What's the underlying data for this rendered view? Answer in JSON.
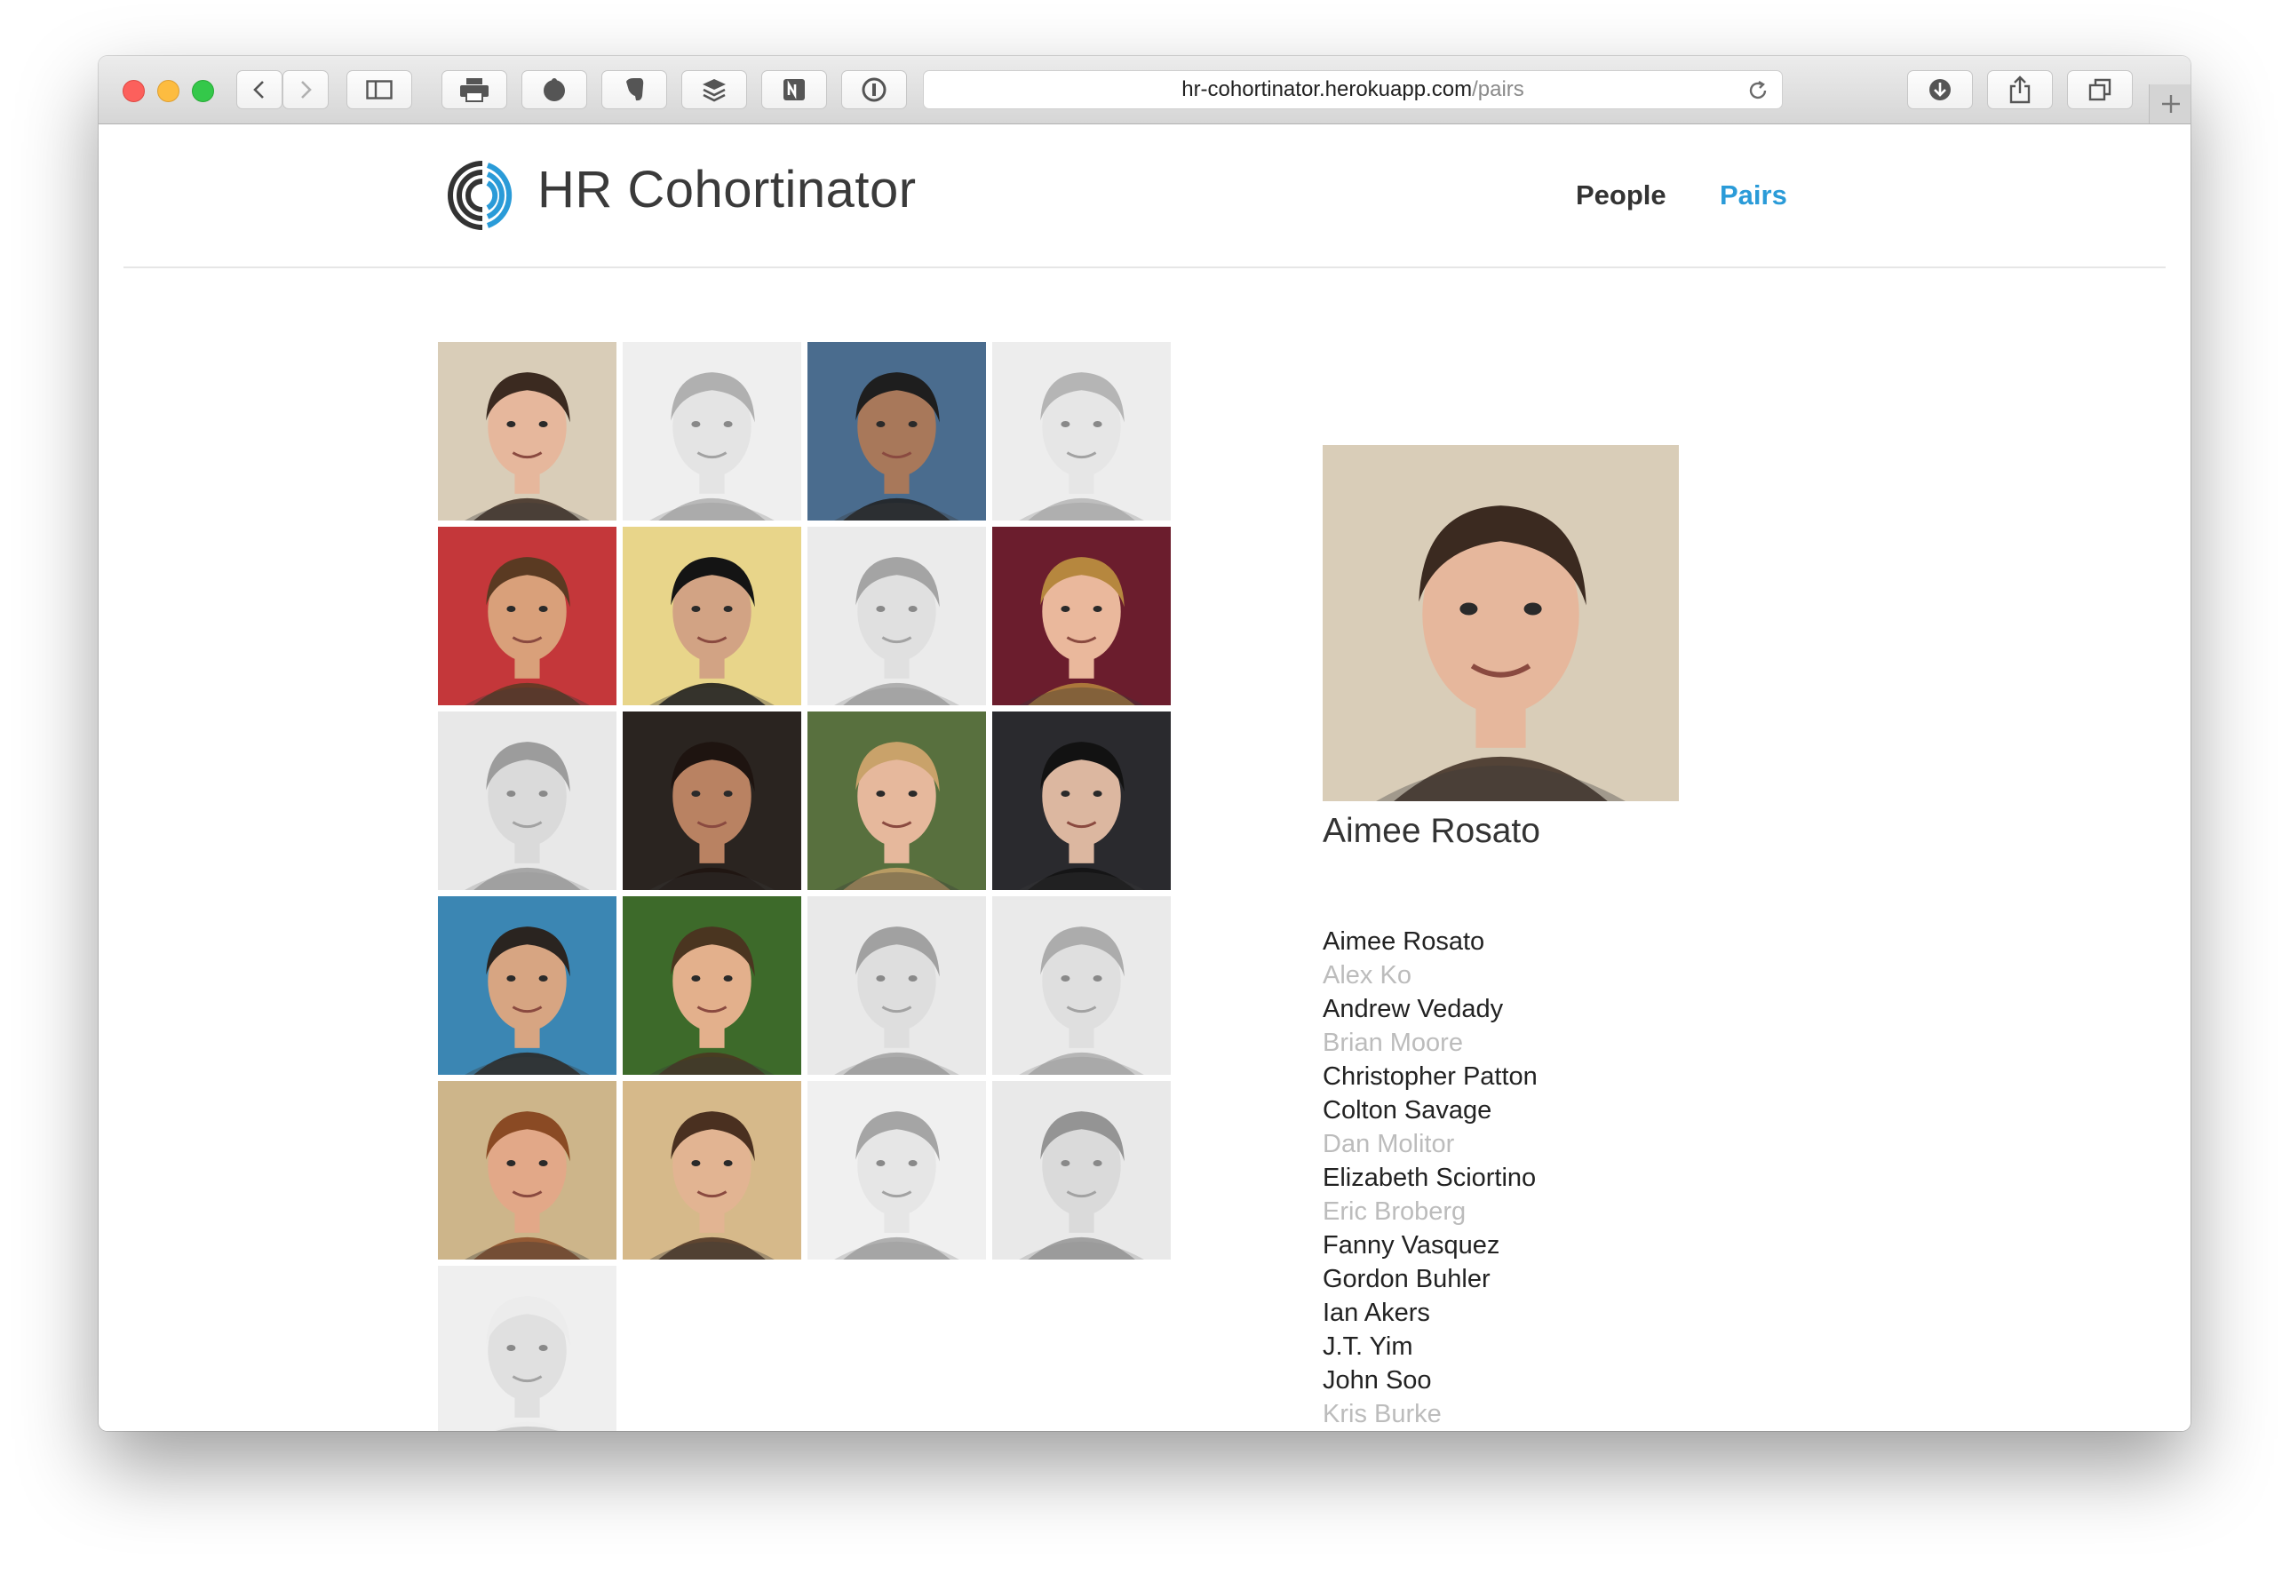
{
  "browser": {
    "url_host": "hr-cohortinator.herokuapp.com",
    "url_path": "/pairs"
  },
  "site": {
    "title": "HR Cohortinator",
    "nav": [
      {
        "label": "People",
        "active": false
      },
      {
        "label": "Pairs",
        "active": true
      }
    ],
    "accent_color": "#2a9bd8"
  },
  "photo_grid": [
    {
      "bg": "#d9cdb8",
      "skin": "#e6b79c",
      "hair": "#3b2a20",
      "gray": false
    },
    {
      "bg": "#e2e2e2",
      "skin": "#cfcfcf",
      "hair": "#707070",
      "gray": true
    },
    {
      "bg": "#4a6c8e",
      "skin": "#a8785a",
      "hair": "#1e1e1e",
      "gray": false
    },
    {
      "bg": "#e0e0e0",
      "skin": "#d3d3d3",
      "hair": "#7a7a7a",
      "gray": true
    },
    {
      "bg": "#c4373a",
      "skin": "#d9a07a",
      "hair": "#5a3a22",
      "gray": false
    },
    {
      "bg": "#e8d58a",
      "skin": "#d2a384",
      "hair": "#141414",
      "gray": false
    },
    {
      "bg": "#dcdcdc",
      "skin": "#c8c8c8",
      "hair": "#5a5a5a",
      "gray": true
    },
    {
      "bg": "#6b1d2d",
      "skin": "#eab89c",
      "hair": "#b6873e",
      "gray": false
    },
    {
      "bg": "#d6d6d6",
      "skin": "#bdbdbd",
      "hair": "#4c4c4c",
      "gray": true
    },
    {
      "bg": "#2a2420",
      "skin": "#b98262",
      "hair": "#1e1410",
      "gray": false
    },
    {
      "bg": "#58703e",
      "skin": "#e6b89c",
      "hair": "#c9a26a",
      "gray": false
    },
    {
      "bg": "#2a2a2e",
      "skin": "#dcb7a0",
      "hair": "#121212",
      "gray": false
    },
    {
      "bg": "#3b86b3",
      "skin": "#d7a582",
      "hair": "#2a2420",
      "gray": false
    },
    {
      "bg": "#3d6a2a",
      "skin": "#e3b08c",
      "hair": "#4a3520",
      "gray": false
    },
    {
      "bg": "#d8d8d8",
      "skin": "#c4c4c4",
      "hair": "#555555",
      "gray": true
    },
    {
      "bg": "#dadada",
      "skin": "#c6c6c6",
      "hair": "#6a6a6a",
      "gray": true
    },
    {
      "bg": "#cdb58a",
      "skin": "#e2a888",
      "hair": "#8a4a24",
      "gray": false
    },
    {
      "bg": "#d6b98a",
      "skin": "#e2b492",
      "hair": "#4a3020",
      "gray": false
    },
    {
      "bg": "#e4e4e4",
      "skin": "#d2d2d2",
      "hair": "#5c5c5c",
      "gray": true
    },
    {
      "bg": "#d8d8d8",
      "skin": "#bcbcbc",
      "hair": "#3e3e3e",
      "gray": true
    },
    {
      "bg": "#e2e2e2",
      "skin": "#c8c8c8",
      "hair": "#dedede",
      "gray": true
    }
  ],
  "selected": {
    "name": "Aimee Rosato"
  },
  "names": [
    {
      "name": "Aimee Rosato",
      "active": true
    },
    {
      "name": "Alex Ko",
      "active": false
    },
    {
      "name": "Andrew Vedady",
      "active": true
    },
    {
      "name": "Brian Moore",
      "active": false
    },
    {
      "name": "Christopher Patton",
      "active": true
    },
    {
      "name": "Colton Savage",
      "active": true
    },
    {
      "name": "Dan Molitor",
      "active": false
    },
    {
      "name": "Elizabeth Sciortino",
      "active": true
    },
    {
      "name": "Eric Broberg",
      "active": false
    },
    {
      "name": "Fanny Vasquez",
      "active": true
    },
    {
      "name": "Gordon Buhler",
      "active": true
    },
    {
      "name": "Ian Akers",
      "active": true
    },
    {
      "name": "J.T. Yim",
      "active": true
    },
    {
      "name": "John Soo",
      "active": true
    },
    {
      "name": "Kris Burke",
      "active": false
    }
  ]
}
